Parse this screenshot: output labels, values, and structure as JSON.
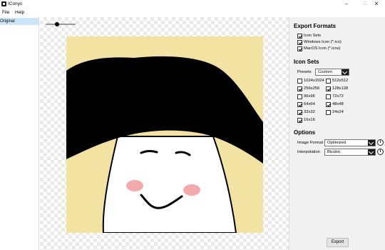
{
  "window": {
    "title": "IConyc",
    "minimize_glyph": "–",
    "maximize_glyph": "□",
    "close_glyph": "✕"
  },
  "menu": {
    "file": "File",
    "help": "Help"
  },
  "left_list": {
    "items": [
      "Original"
    ]
  },
  "preview": {
    "zoom_fraction": 0.5
  },
  "export_formats": {
    "title": "Export Formats",
    "items": [
      {
        "label": "Icon Sets",
        "checked": true
      },
      {
        "label": "Windows Icon (*.ico)",
        "checked": true
      },
      {
        "label": "MacOS Icon (*.icns)",
        "checked": true
      }
    ]
  },
  "icon_sets": {
    "title": "Icon Sets",
    "presets_label": "Presets",
    "presets_value": "Custom",
    "sizes": [
      {
        "label": "1024x1024",
        "checked": false
      },
      {
        "label": "512x512",
        "checked": false
      },
      {
        "label": "256x256",
        "checked": true
      },
      {
        "label": "128x128",
        "checked": true
      },
      {
        "label": "96x96",
        "checked": false
      },
      {
        "label": "72x72",
        "checked": false
      },
      {
        "label": "64x64",
        "checked": true
      },
      {
        "label": "48x48",
        "checked": true
      },
      {
        "label": "32x32",
        "checked": true
      },
      {
        "label": "24x24",
        "checked": false
      },
      {
        "label": "16x16",
        "checked": true
      }
    ]
  },
  "options": {
    "title": "Options",
    "image_format_label": "Image Format",
    "image_format_value": "Optimized",
    "interpolation_label": "Interpolation",
    "interpolation_value": "Bicubic",
    "info_glyph": "i"
  },
  "export_button": "Export",
  "colors": {
    "selection": "#cde6f7",
    "preview_bg": "#f3e3a3",
    "hat": "#000000",
    "cheek": "#f4a9ad"
  }
}
